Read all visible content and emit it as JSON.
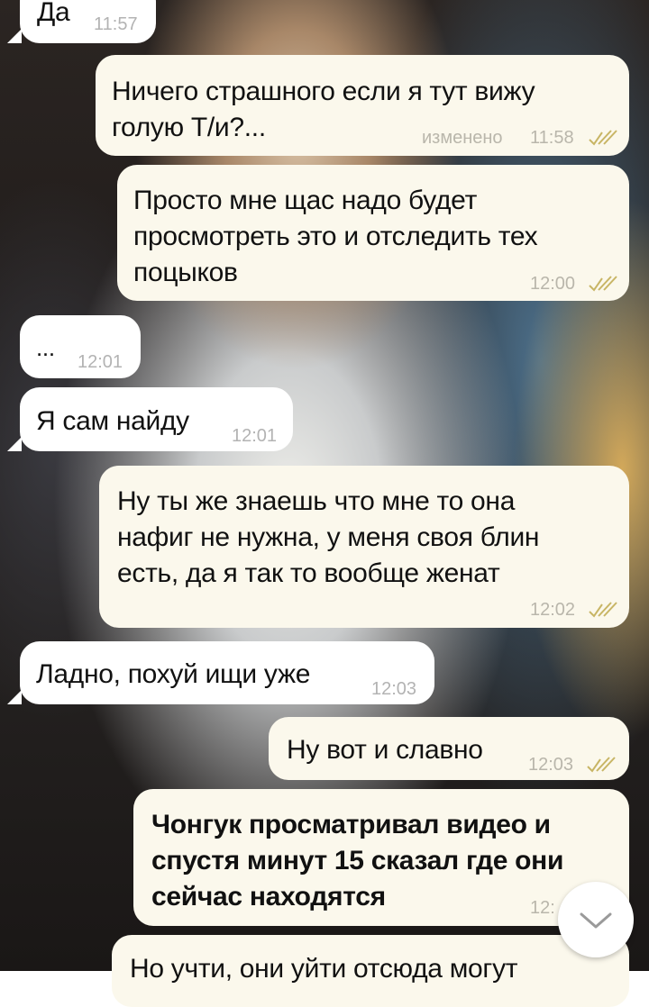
{
  "messages": [
    {
      "type": "in",
      "lines": [
        "Да"
      ],
      "time": "11:57"
    },
    {
      "type": "out",
      "lines": [
        "Ничего страшного если я тут вижу",
        "голую Т/и?..."
      ],
      "status": "изменено",
      "time": "11:58"
    },
    {
      "type": "out",
      "lines": [
        "Просто мне щас надо будет",
        "просмотреть это и отследить тех",
        "поцыков"
      ],
      "time": "12:00"
    },
    {
      "type": "in",
      "lines": [
        "..."
      ],
      "time": "12:01"
    },
    {
      "type": "in",
      "lines": [
        "Я сам найду"
      ],
      "time": "12:01"
    },
    {
      "type": "out",
      "lines": [
        "Ну ты же знаешь что мне то она",
        "нафиг не нужна, у меня своя блин",
        "есть, да я так то вообще женат"
      ],
      "time": "12:02"
    },
    {
      "type": "in",
      "lines": [
        "Ладно, похуй ищи уже"
      ],
      "time": "12:03"
    },
    {
      "type": "out",
      "lines": [
        "Ну вот и славно"
      ],
      "time": "12:03"
    },
    {
      "type": "out",
      "lines": [
        "Чонгук просматривал видео и",
        "спустя минут 15 сказал где они",
        "сейчас находятся"
      ],
      "time": "12:",
      "bold": true
    },
    {
      "type": "out",
      "lines": [
        "Но учти, они уйти отсюда могут"
      ]
    }
  ],
  "colors": {
    "incoming_bubble": "#ffffff",
    "outgoing_bubble": "#fbf8ec",
    "read_check": "#c8b565"
  },
  "icons": {
    "read_receipt": "double-check-icon",
    "scroll_down": "chevron-down-icon"
  }
}
